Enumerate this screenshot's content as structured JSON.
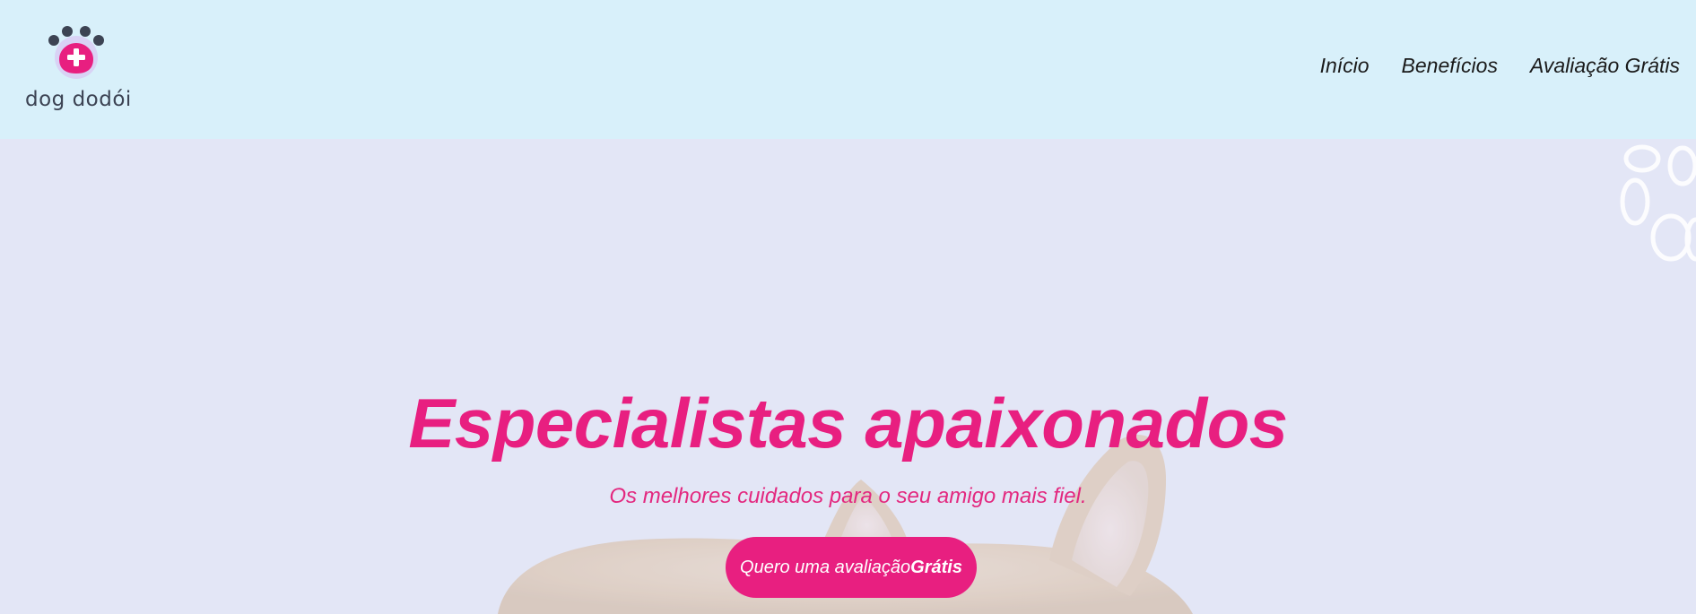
{
  "brand": {
    "name": "dog dodói",
    "icon": "paw-plus-icon",
    "colors": {
      "paw_dots": "#3c4353",
      "heart_pink": "#e81f80",
      "halo": "#d9d2f5"
    }
  },
  "nav": {
    "items": [
      {
        "label": "Início"
      },
      {
        "label": "Benefícios"
      },
      {
        "label": "Avaliação Grátis"
      }
    ]
  },
  "hero": {
    "title": "Especialistas apaixonados",
    "subtitle": "Os melhores cuidados para o seu amigo mais fiel.",
    "cta": {
      "label_regular": "Quero uma avaliação",
      "label_bold": "Grátis"
    },
    "background_image": "corgi-dog-photo",
    "decoration_icon": "paw-outline-icon"
  },
  "colors": {
    "header_bg": "#d8f0fa",
    "hero_bg": "#e3e6f6",
    "accent": "#e81f80",
    "nav_text": "#1a1a1a"
  }
}
